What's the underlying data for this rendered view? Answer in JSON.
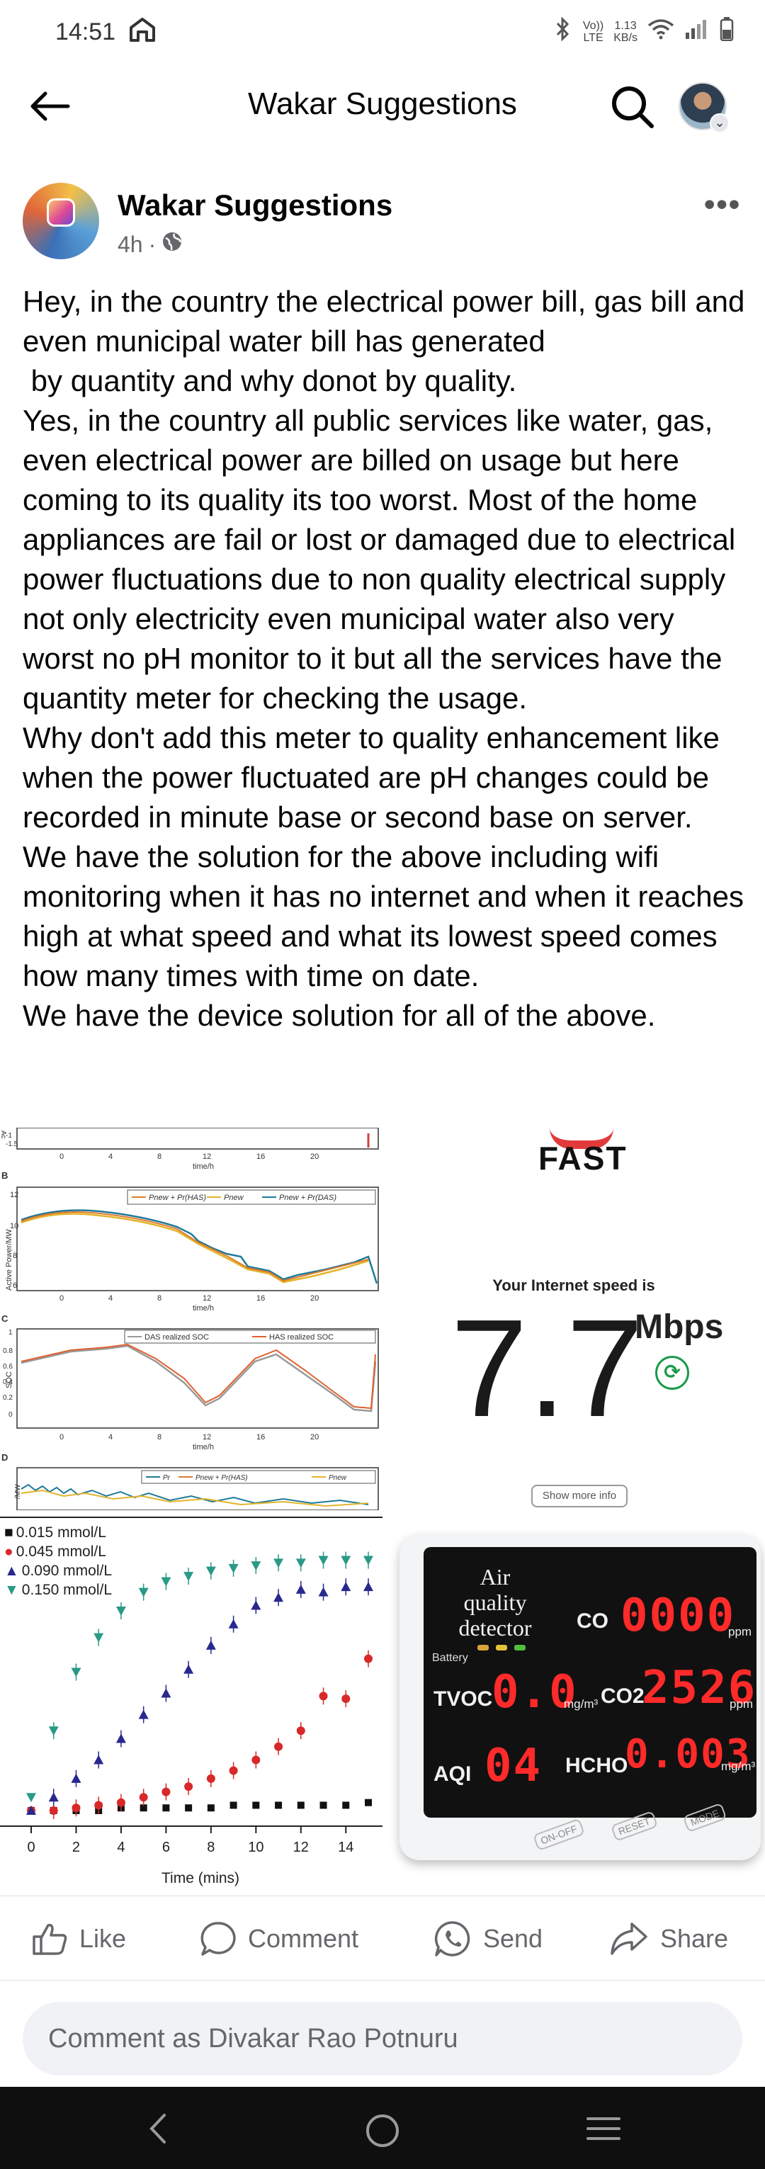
{
  "status_bar": {
    "time": "14:51",
    "network_label_top": "Vo))",
    "network_label_bottom": "LTE",
    "speed_value": "1.13",
    "speed_unit": "KB/s"
  },
  "header": {
    "title": "Wakar Suggestions"
  },
  "post": {
    "page_name": "Wakar Suggestions",
    "time_ago": "4h",
    "separator": "·",
    "paragraphs": [
      "Hey, in the country the electrical power bill, gas bill and even municipal water bill has generated\n by quantity and why donot by quality.",
      "Yes, in the country all public services like water, gas, even electrical power are billed on usage but here coming to its quality its too worst. Most of the home appliances are fail or lost or damaged due to electrical power fluctuations due to non quality electrical supply not only electricity even municipal water also very worst no pH monitor to it but all the services have the quantity meter for checking the usage.",
      "Why don't add this meter to quality enhancement like when the power fluctuated are pH changes could be recorded in minute base or second base on server.",
      "We have the solution for the above including wifi monitoring when it has no internet and when it reaches high at what speed and what its lowest speed comes how many times with time on date.",
      "We have the device solution for all of the above."
    ]
  },
  "collage": {
    "soc_chart": {
      "panel_b": "B",
      "panel_c": "C",
      "panel_d": "D",
      "ylabel_b": "Active Power/MW",
      "ylabel_c": "SOC",
      "ylabel_d": "/MW",
      "xlabel": "time/h",
      "legend_b": [
        "Pnew + Pr(HAS)",
        "Pnew",
        "Pnew + Pr(DAS)"
      ],
      "legend_c": [
        "DAS realized SOC",
        "HAS realized SOC"
      ],
      "legend_d": [
        "Pr",
        "Pnew + Pr(HAS)",
        "Pnew"
      ],
      "x_ticks": [
        "4",
        "8",
        "12",
        "16",
        "20"
      ],
      "y_ticks_b": [
        "12",
        "10",
        "8",
        "6"
      ],
      "y_ticks_c": [
        "1",
        "0.8",
        "0.6",
        "0.4",
        "0.2",
        "0"
      ]
    },
    "speed_test": {
      "logo": "FAST",
      "caption": "Your Internet speed is",
      "value": "7.7",
      "unit": "Mbps",
      "more_info": "Show more info"
    },
    "conc_chart": {
      "xlabel": "Time (mins)",
      "x_ticks": [
        "0",
        "2",
        "4",
        "6",
        "8",
        "10",
        "12",
        "14"
      ]
    },
    "detector": {
      "title_line1": "Air",
      "title_line2": "quality detector",
      "battery_label": "Battery",
      "co_label": "CO",
      "co_value": "0000",
      "co_unit": "ppm",
      "co2_label": "CO2",
      "co2_value": "2526",
      "co2_unit": "ppm",
      "tvoc_label": "TVOC",
      "tvoc_value": "0.0",
      "tvoc_unit": "mg/m³",
      "hcho_label": "HCHO",
      "hcho_value": "0.003",
      "hcho_unit": "mg/m³",
      "aqi_label": "AQI",
      "aqi_value": "04",
      "btn_onoff": "ON-OFF",
      "btn_reset": "RESET",
      "btn_mode": "MODE"
    }
  },
  "chart_data": {
    "type": "scatter",
    "xlabel": "Time (mins)",
    "ylabel": "",
    "xlim": [
      0,
      15
    ],
    "ylim": [
      0,
      1
    ],
    "series": [
      {
        "name": "0.015 mmol/L",
        "color": "#111111",
        "marker": "square",
        "x": [
          0,
          1,
          2,
          3,
          4,
          5,
          6,
          7,
          8,
          9,
          10,
          11,
          12,
          13,
          14,
          15
        ],
        "y": [
          0,
          0,
          0,
          0,
          0.01,
          0.01,
          0.01,
          0.01,
          0.01,
          0.02,
          0.02,
          0.02,
          0.02,
          0.02,
          0.02,
          0.03
        ]
      },
      {
        "name": "0.045 mmol/L",
        "color": "#d8282a",
        "marker": "circle",
        "x": [
          0,
          1,
          2,
          3,
          4,
          5,
          6,
          7,
          8,
          9,
          10,
          11,
          12,
          13,
          14,
          15
        ],
        "y": [
          0,
          0,
          0.01,
          0.02,
          0.03,
          0.05,
          0.07,
          0.09,
          0.12,
          0.15,
          0.19,
          0.24,
          0.3,
          0.43,
          0.42,
          0.57
        ]
      },
      {
        "name": "0.090 mmol/L",
        "color": "#28288f",
        "marker": "triangle-up",
        "x": [
          0,
          1,
          2,
          3,
          4,
          5,
          6,
          7,
          8,
          9,
          10,
          11,
          12,
          13,
          14,
          15
        ],
        "y": [
          0,
          0.05,
          0.12,
          0.19,
          0.27,
          0.36,
          0.44,
          0.53,
          0.62,
          0.7,
          0.77,
          0.8,
          0.83,
          0.82,
          0.84,
          0.84
        ]
      },
      {
        "name": "0.150 mmol/L",
        "color": "#2a9a86",
        "marker": "triangle-down",
        "x": [
          0,
          1,
          2,
          3,
          4,
          5,
          6,
          7,
          8,
          9,
          10,
          11,
          12,
          13,
          14,
          15
        ],
        "y": [
          0.05,
          0.3,
          0.52,
          0.65,
          0.75,
          0.82,
          0.86,
          0.88,
          0.9,
          0.91,
          0.92,
          0.93,
          0.93,
          0.94,
          0.94,
          0.94
        ]
      }
    ]
  },
  "actions": {
    "like": "Like",
    "comment": "Comment",
    "send": "Send",
    "share": "Share"
  },
  "comment_input": {
    "placeholder": "Comment as Divakar Rao Potnuru"
  }
}
